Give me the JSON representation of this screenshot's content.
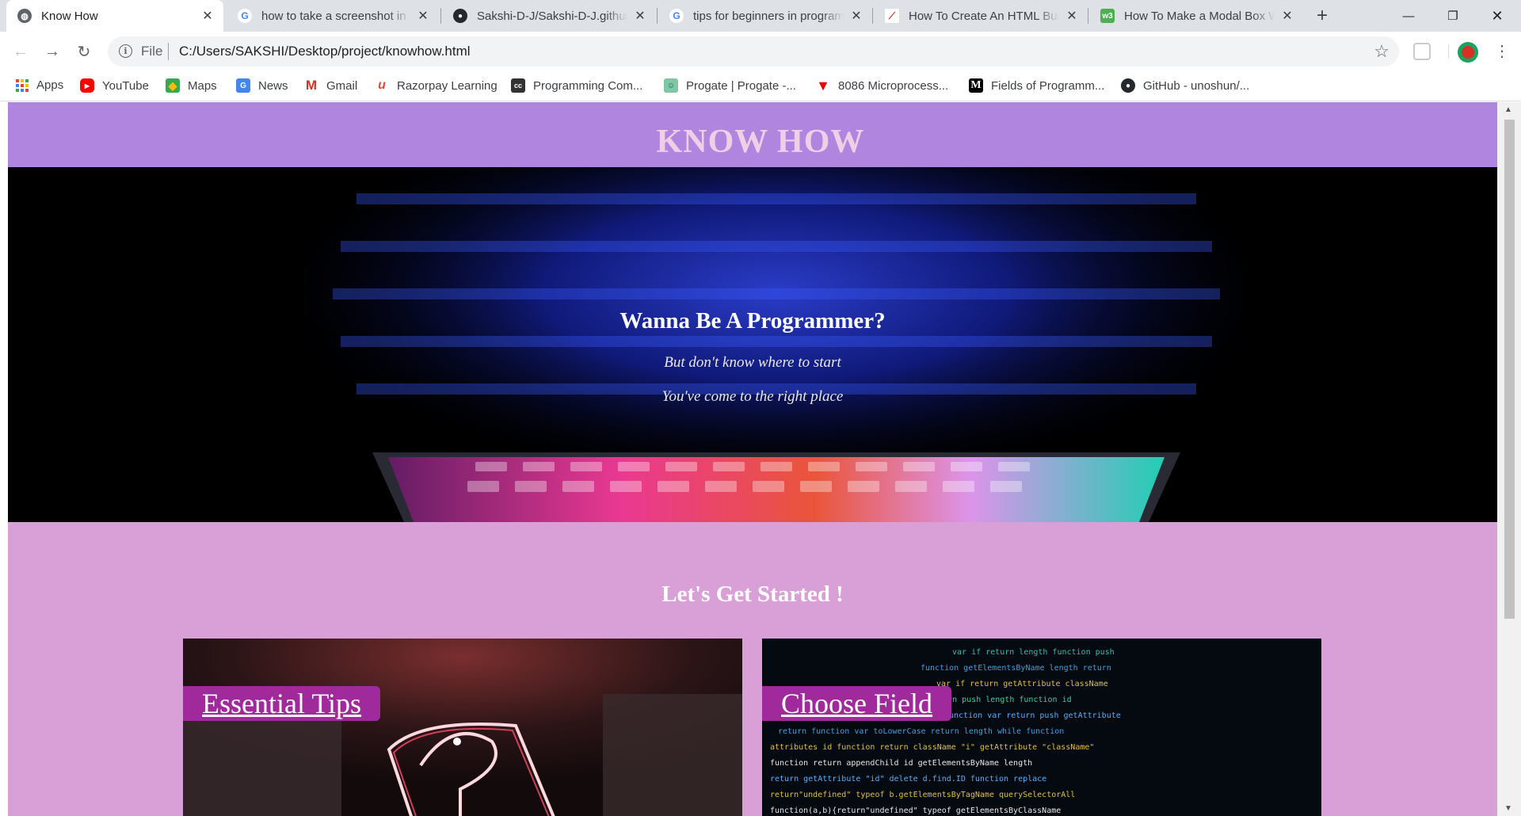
{
  "browser": {
    "tabs": [
      {
        "title": "Know How",
        "active": true,
        "icon": "globe-icon"
      },
      {
        "title": "how to take a screenshot in w",
        "active": false,
        "icon": "google-icon"
      },
      {
        "title": "Sakshi-D-J/Sakshi-D-J.github.",
        "active": false,
        "icon": "github-icon"
      },
      {
        "title": "tips for beginners in program",
        "active": false,
        "icon": "google-icon"
      },
      {
        "title": "How To Create An HTML Butt",
        "active": false,
        "icon": "article-icon"
      },
      {
        "title": "How To Make a Modal Box W",
        "active": false,
        "icon": "w3schools-icon"
      }
    ],
    "address": {
      "scheme_label": "File",
      "url": "C:/Users/SAKSHI/Desktop/project/knowhow.html"
    },
    "bookmarks": [
      {
        "label": "Apps",
        "icon": "apps-grid-icon"
      },
      {
        "label": "YouTube",
        "icon": "youtube-icon"
      },
      {
        "label": "Maps",
        "icon": "maps-icon"
      },
      {
        "label": "News",
        "icon": "news-icon"
      },
      {
        "label": "Gmail",
        "icon": "gmail-icon"
      },
      {
        "label": "Razorpay Learning",
        "icon": "razorpay-icon"
      },
      {
        "label": "Programming Com...",
        "icon": "cc-icon"
      },
      {
        "label": "Progate | Progate -...",
        "icon": "progate-icon"
      },
      {
        "label": "8086 Microprocess...",
        "icon": "triangle-icon"
      },
      {
        "label": "Fields of Programm...",
        "icon": "medium-icon"
      },
      {
        "label": "GitHub - unoshun/...",
        "icon": "github-icon"
      }
    ]
  },
  "page": {
    "site_title": "KNOW HOW",
    "hero": {
      "heading": "Wanna Be A Programmer?",
      "line1": "But don't know where to start",
      "line2": "You've come to the right place"
    },
    "section_title": "Let's Get Started !",
    "cards": [
      {
        "label": "Essential Tips"
      },
      {
        "label": "Choose Field"
      }
    ]
  },
  "colors": {
    "header_bg": "#b085df",
    "title_color": "#f0cfe6",
    "page_bg": "#d8a0d6",
    "card_label_bg": "#a02a9c"
  }
}
